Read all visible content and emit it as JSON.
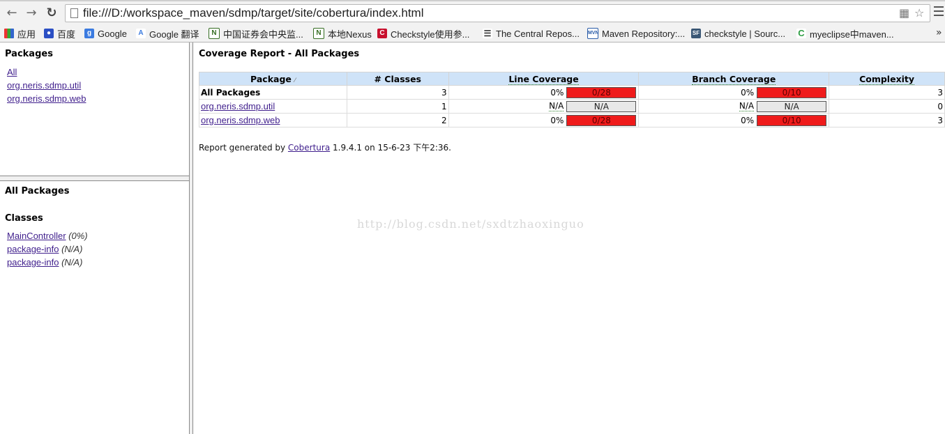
{
  "browser": {
    "url": "file:///D:/workspace_maven/sdmp/target/site/cobertura/index.html",
    "bookmarks": [
      {
        "label": "应用",
        "icon": "apps-grid-icon"
      },
      {
        "label": "百度",
        "icon": "baidu-icon"
      },
      {
        "label": "Google",
        "icon": "google-icon"
      },
      {
        "label": "Google 翻译",
        "icon": "google-translate-icon"
      },
      {
        "label": "中国证券会中央监...",
        "icon": "nexus-icon"
      },
      {
        "label": "本地Nexus",
        "icon": "nexus-icon"
      },
      {
        "label": "Checkstyle使用参...",
        "icon": "checkstyle-icon"
      },
      {
        "label": "The Central Repos...",
        "icon": "document-icon"
      },
      {
        "label": "Maven Repository:...",
        "icon": "maven-icon"
      },
      {
        "label": "checkstyle | Sourc...",
        "icon": "sourceforge-icon"
      },
      {
        "label": "myeclipse中maven...",
        "icon": "chrome-c-icon"
      }
    ],
    "more": "»"
  },
  "packages_frame": {
    "title": "Packages",
    "links": [
      "All",
      "org.neris.sdmp.util",
      "org.neris.sdmp.web"
    ]
  },
  "classes_frame": {
    "title": "All Packages",
    "subtitle": "Classes",
    "items": [
      {
        "name": "MainController",
        "coverage": "(0%)"
      },
      {
        "name": "package-info",
        "coverage": "(N/A)"
      },
      {
        "name": "package-info",
        "coverage": "(N/A)"
      }
    ]
  },
  "report": {
    "title": "Coverage Report - All Packages",
    "columns": [
      "Package",
      "# Classes",
      "Line Coverage",
      "Branch Coverage",
      "Complexity"
    ],
    "sort_marker": "⁄",
    "rows": [
      {
        "package": "All Packages",
        "classes": "3",
        "line_pct": "0%",
        "line_bar": "0/28",
        "line_fill": 0,
        "branch_pct": "0%",
        "branch_bar": "0/10",
        "branch_fill": 0,
        "complexity": "3"
      },
      {
        "package": "org.neris.sdmp.util",
        "classes": "1",
        "line_pct": "N/A",
        "line_bar": "N/A",
        "branch_pct": "N/A",
        "branch_bar": "N/A",
        "complexity": "0"
      },
      {
        "package": "org.neris.sdmp.web",
        "classes": "2",
        "line_pct": "0%",
        "line_bar": "0/28",
        "line_fill": 0,
        "branch_pct": "0%",
        "branch_bar": "0/10",
        "branch_fill": 0,
        "complexity": "3"
      }
    ],
    "footer_prefix": "Report generated by ",
    "footer_link": "Cobertura",
    "footer_suffix": " 1.9.4.1 on 15-6-23 下午2:36."
  },
  "watermark": "http://blog.csdn.net/sxdtzhaoxinguo",
  "colors": {
    "uncovered": "#ef1b1b",
    "header_bg": "#cfe3f8",
    "link": "#3f1e8c"
  }
}
